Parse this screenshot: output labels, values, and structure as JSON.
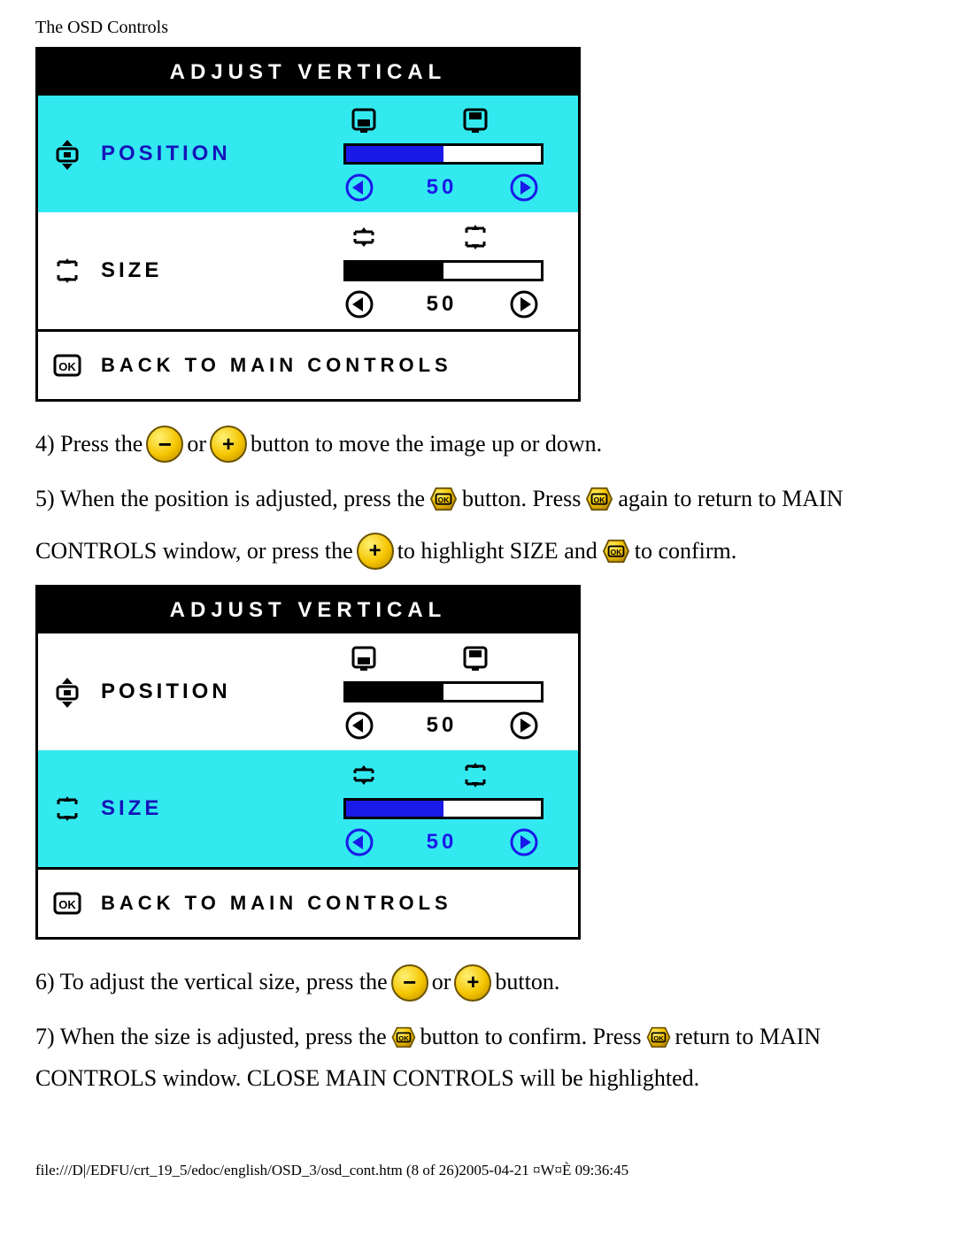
{
  "page_title": "The OSD Controls",
  "osd": {
    "header": "ADJUST VERTICAL",
    "position": {
      "label": "POSITION",
      "value": "50",
      "fill_pct": 50
    },
    "size": {
      "label": "SIZE",
      "value": "50",
      "fill_pct": 50
    },
    "footer": "BACK TO MAIN CONTROLS"
  },
  "steps": {
    "s4a": "4) Press the",
    "s4b": "or",
    "s4c": "button to move the image up or down.",
    "s5a": "5) When the position is adjusted, press the",
    "s5b": "button. Press",
    "s5c": "again to return to MAIN",
    "s5d": "CONTROLS window, or press the",
    "s5e": "to highlight SIZE and",
    "s5f": "to confirm.",
    "s6a": "6) To adjust the vertical size, press the",
    "s6b": "or",
    "s6c": "button.",
    "s7a": "7) When the size is adjusted, press the",
    "s7b": "button to confirm. Press",
    "s7c": "return to MAIN",
    "s7d": "CONTROLS window. CLOSE MAIN CONTROLS will be highlighted."
  },
  "footer": "file:///D|/EDFU/crt_19_5/edoc/english/OSD_3/osd_cont.htm (8 of 26)2005-04-21 ¤W¤È 09:36:45"
}
